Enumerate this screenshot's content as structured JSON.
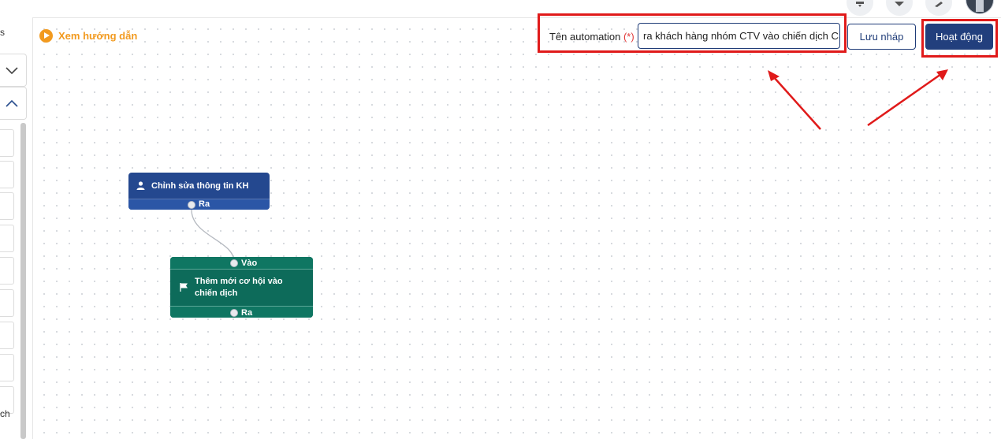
{
  "topbar": {
    "icons": [
      "bell-icon",
      "send-icon",
      "rocket-icon"
    ],
    "avatar": "user-avatar"
  },
  "left_panel": {
    "top_label": "s",
    "bottom_label": "ch"
  },
  "guide": {
    "label": "Xem hướng dẫn",
    "icon": "play-icon"
  },
  "automation": {
    "name_label": "Tên automation",
    "required_mark": "(*)",
    "name_value": "ra khách hàng nhóm CTV vào chiến dịch CS"
  },
  "actions": {
    "draft_label": "Lưu nháp",
    "activate_label": "Hoạt động"
  },
  "flow": {
    "node1": {
      "title": "Chỉnh sửa thông tin KH",
      "out_label": "Ra",
      "icon": "user-icon"
    },
    "node2": {
      "title": "Thêm mới cơ hội vào chiến dịch",
      "in_label": "Vào",
      "out_label": "Ra",
      "icon": "flag-icon"
    }
  },
  "colors": {
    "accent": "#f29a1f",
    "primary": "#223f7d",
    "node_blue": "#24488f",
    "node_green": "#0d6b5a",
    "highlight": "#e01a1a"
  }
}
